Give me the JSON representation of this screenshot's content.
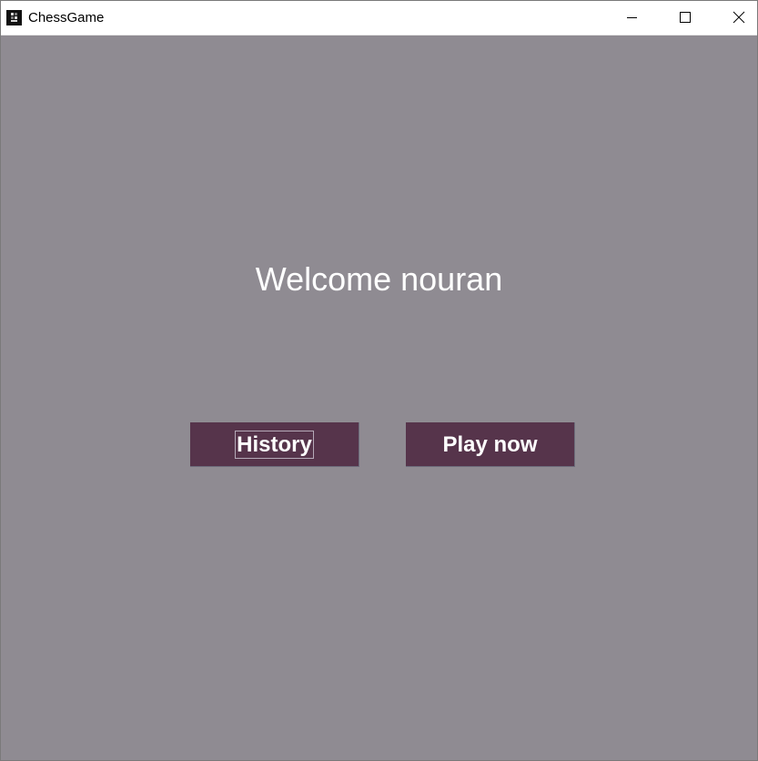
{
  "window": {
    "title": "ChessGame",
    "icon": "chess-app-icon",
    "controls": [
      "minimize-icon",
      "maximize-icon",
      "close-icon"
    ]
  },
  "main": {
    "welcome_text": "Welcome nouran",
    "history_label": "History",
    "play_label": "Play now",
    "focused_button": "history"
  },
  "colors": {
    "background": "#8f8b92",
    "button": "#56344b",
    "text": "#ffffff"
  }
}
